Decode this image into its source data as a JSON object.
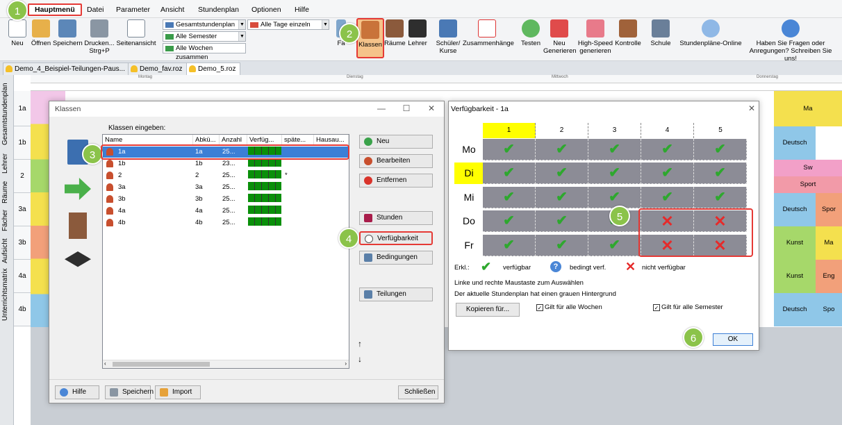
{
  "menu": [
    "Hauptmenü",
    "Datei",
    "Parameter",
    "Ansicht",
    "Stundenplan",
    "Optionen",
    "Hilfe"
  ],
  "ribbon": {
    "neu": "Neu",
    "oeffnen": "Öffnen",
    "speichern": "Speichern",
    "drucken1": "Drucken...",
    "drucken2": "Strg+P",
    "seitenansicht": "Seitenansicht",
    "combo_plan": "Gesamtstundenplan",
    "combo_semester": "Alle Semester",
    "combo_wochen": "Alle Wochen zusammen",
    "combo_tage": "Alle Tage einzeln",
    "faecher": "Fä",
    "klassen": "Klassen",
    "raeume": "Räume",
    "lehrer": "Lehrer",
    "schueler1": "Schüler/",
    "schueler2": "Kurse",
    "zusammen": "Zusammenhänge",
    "testen": "Testen",
    "neu_gen1": "Neu",
    "neu_gen2": "Generieren",
    "hs1": "High-Speed",
    "hs2": "generieren",
    "kontrolle": "Kontrolle",
    "schule": "Schule",
    "online": "Stundenpläne-Online",
    "fragen1": "Haben Sie Fragen oder",
    "fragen2": "Anregungen? Schreiben Sie uns!"
  },
  "doc_tabs": [
    "Demo_4_Beispiel-Teilungen-Paus...",
    "Demo_fav.roz",
    "Demo_5.roz"
  ],
  "side_tabs": [
    "Gesamtstundenplan",
    "Lehrer",
    "Räume",
    "Fächer",
    "Aufsicht",
    "Unterrichtsmatrix"
  ],
  "timetable": {
    "days": [
      "Montag",
      "Dienstag",
      "Mittwoch",
      "Donnerstag"
    ],
    "rows": [
      "1a",
      "1b",
      "2",
      "3a",
      "3b",
      "4a",
      "4b"
    ],
    "right_cells": [
      "Ma",
      "Deutsch",
      "Sw",
      "Sport",
      "Deutsch",
      "Spor",
      "Kunst",
      "Ma",
      "Kunst",
      "Eng",
      "Deutsch",
      "Spo"
    ]
  },
  "klassen": {
    "title": "Klassen",
    "label": "Klassen eingeben:",
    "columns": [
      "Name",
      "Abkü...",
      "Anzahl",
      "Verfüg...",
      "späte...",
      "Hausau..."
    ],
    "rows": [
      {
        "name": "1a",
        "abk": "1a",
        "anzahl": "25...",
        "spaeter": ""
      },
      {
        "name": "1b",
        "abk": "1b",
        "anzahl": "23...",
        "spaeter": ""
      },
      {
        "name": "2",
        "abk": "2",
        "anzahl": "25...",
        "spaeter": "*"
      },
      {
        "name": "3a",
        "abk": "3a",
        "anzahl": "25...",
        "spaeter": ""
      },
      {
        "name": "3b",
        "abk": "3b",
        "anzahl": "25...",
        "spaeter": ""
      },
      {
        "name": "4a",
        "abk": "4a",
        "anzahl": "25...",
        "spaeter": ""
      },
      {
        "name": "4b",
        "abk": "4b",
        "anzahl": "25...",
        "spaeter": ""
      }
    ],
    "btn_neu": "Neu",
    "btn_bearbeiten": "Bearbeiten",
    "btn_entfernen": "Entfernen",
    "btn_stunden": "Stunden",
    "btn_verfuegbarkeit": "Verfügbarkeit",
    "btn_bedingungen": "Bedingungen",
    "btn_teilungen": "Teilungen",
    "btn_hilfe": "Hilfe",
    "btn_speichern": "Speichern",
    "btn_import": "Import",
    "btn_schliessen": "Schließen",
    "arrow_up": "↑",
    "arrow_down": "↓"
  },
  "verf": {
    "title": "Verfügbarkeit - 1a",
    "periods": [
      "1",
      "2",
      "3",
      "4",
      "5"
    ],
    "days": [
      "Mo",
      "Di",
      "Mi",
      "Do",
      "Fr"
    ],
    "legend_label": "Erkl.:",
    "legend_avail": "verfügbar",
    "legend_cond": "bedingt verf.",
    "legend_not": "nicht verfügbar",
    "hint1": "Linke und rechte Maustaste zum Auswählen",
    "hint2": "Der aktuelle Stundenplan hat einen grauen Hintergrund",
    "btn_kopieren": "Kopieren für...",
    "chk_wochen": "Gilt für alle Wochen",
    "chk_semester": "Gilt für alle Semester",
    "btn_ok": "OK",
    "check_glyph": "✔",
    "cross_glyph": "✕",
    "q_glyph": "?"
  },
  "badges": [
    "1",
    "2",
    "3",
    "4",
    "5",
    "6"
  ],
  "colors": {
    "accent_red": "#e53935",
    "badge_green": "#8bc34a",
    "avail_green": "#2ea82e",
    "cross_red": "#e62a2a",
    "highlight_yellow": "#ffff00",
    "selection_blue": "#3c7fd6"
  }
}
